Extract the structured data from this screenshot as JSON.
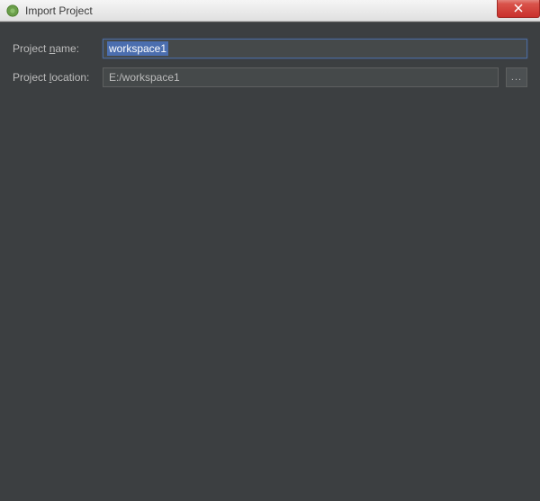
{
  "window": {
    "title": "Import Project"
  },
  "form": {
    "project_name_label_pre": "Project ",
    "project_name_mnemonic": "n",
    "project_name_label_post": "ame:",
    "project_name_value": "workspace1",
    "project_location_label_pre": "Project ",
    "project_location_mnemonic": "l",
    "project_location_label_post": "ocation:",
    "project_location_value": "E:/workspace1",
    "browse_label": "..."
  }
}
